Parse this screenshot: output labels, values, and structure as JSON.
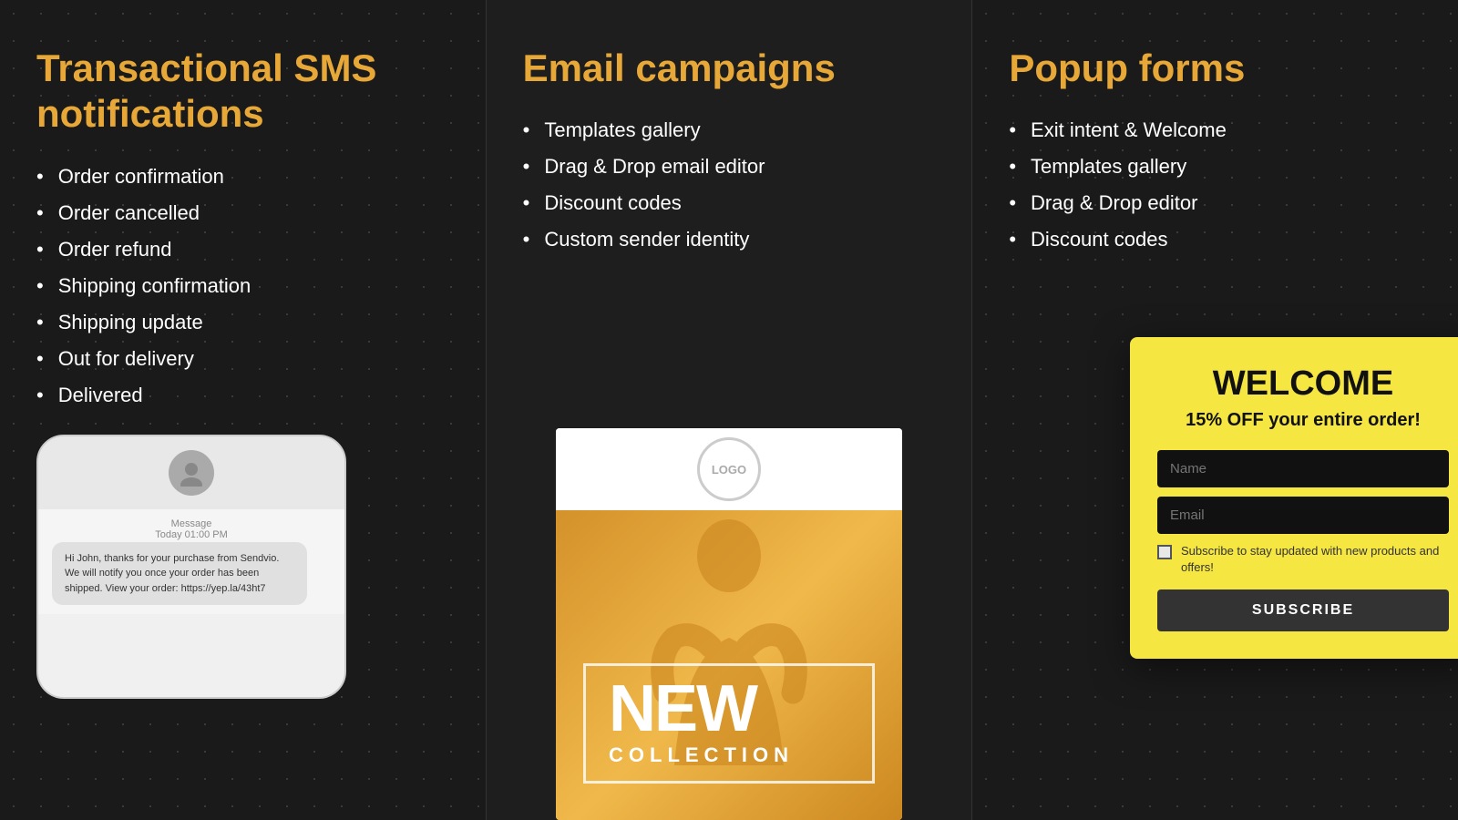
{
  "column1": {
    "title": "Transactional SMS notifications",
    "features": [
      "Order confirmation",
      "Order cancelled",
      "Order refund",
      "Shipping confirmation",
      "Shipping update",
      "Out for delivery",
      "Delivered"
    ],
    "phone": {
      "message_label": "Message",
      "time_label": "Today 01:00 PM",
      "message_text": "Hi John, thanks for your purchase from Sendvio. We will notify you once your order has been shipped. View your order: https://yep.la/43ht7"
    }
  },
  "column2": {
    "title": "Email campaigns",
    "features": [
      "Templates gallery",
      "Drag & Drop email editor",
      "Discount codes",
      "Custom sender identity"
    ],
    "email": {
      "logo_text": "LOGO",
      "new_text": "NEW",
      "collection_text": "COLLECTION"
    }
  },
  "column3": {
    "title": "Popup forms",
    "features": [
      "Exit intent & Welcome",
      "Templates gallery",
      "Drag & Drop editor",
      "Discount codes"
    ],
    "popup": {
      "close_icon": "×",
      "welcome_title": "WELCOME",
      "discount_text": "15% OFF your entire order!",
      "name_placeholder": "Name",
      "email_placeholder": "Email",
      "checkbox_text": "Subscribe to stay updated with new products and offers!",
      "subscribe_btn": "SUBSCRIBE"
    }
  }
}
